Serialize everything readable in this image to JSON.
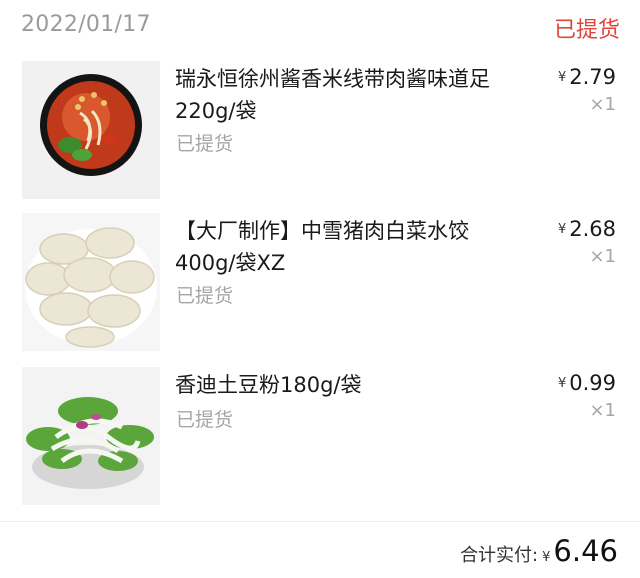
{
  "order": {
    "date": "2022/01/17",
    "status": "已提货",
    "items": [
      {
        "title": "瑞永恒徐州酱香米线带肉酱味道足220g/袋",
        "status": "已提货",
        "currency": "¥",
        "price": "2.79",
        "qty": "×1",
        "image": "spicy-noodle-bowl"
      },
      {
        "title": "【大厂制作】中雪猪肉白菜水饺400g/袋XZ",
        "status": "已提货",
        "currency": "¥",
        "price": "2.68",
        "qty": "×1",
        "image": "dumplings-plate"
      },
      {
        "title": "香迪土豆粉180g/袋",
        "status": "已提货",
        "currency": "¥",
        "price": "0.99",
        "qty": "×1",
        "image": "potato-noodle-salad"
      }
    ],
    "total": {
      "label": "合计实付:",
      "currency": "¥",
      "value": "6.46"
    }
  }
}
